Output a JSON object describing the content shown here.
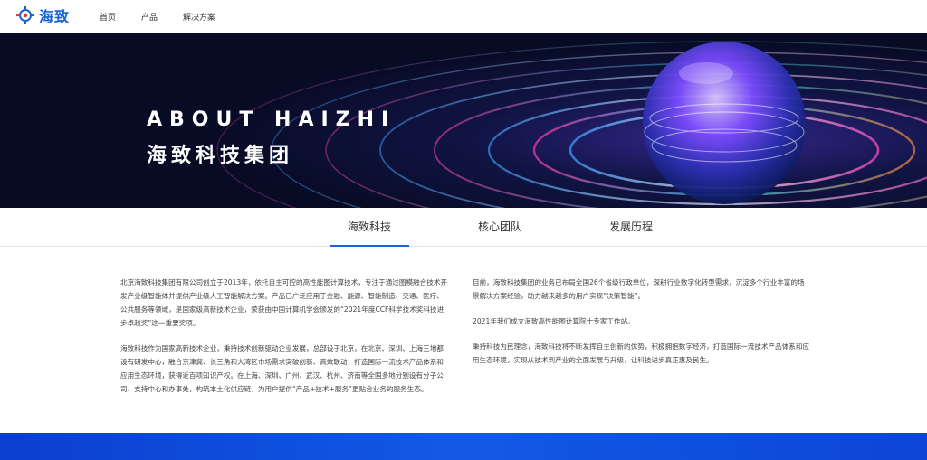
{
  "header": {
    "logo_text": "海致",
    "nav": [
      "首页",
      "产品",
      "解决方案"
    ]
  },
  "hero": {
    "title_en": "ABOUT HAIZHI",
    "title_cn": "海致科技集团"
  },
  "tabs": [
    {
      "label": "海致科技",
      "active": true
    },
    {
      "label": "核心团队",
      "active": false
    },
    {
      "label": "发展历程",
      "active": false
    }
  ],
  "content": {
    "left": [
      "北京海致科技集团有限公司创立于2013年，依托自主可控的高性能图计算技术，专注于通过图模融合技术开发产业级智能体并提供产业级人工智能解决方案。产品已广泛应用于金融、能源、智能制造、交通、医疗、公共服务等领域，是国家级高新技术企业，荣获由中国计算机学会颁发的“2021年度CCF科学技术奖科技进步卓越奖”这一重要奖项。",
      "海致科技作为国家高新技术企业，秉持技术创新驱动企业发展，总部设于北京，在北京、深圳、上海三地都设有研发中心，融合京津冀、长三角和大湾区市场需求突破创新、高效联动，打造国际一流技术产品体系和应用生态环境，获得近百项知识产权。在上海、深圳、广州、武汉、杭州、济南等全国多地分别设有分子公司、支持中心和办事处，构筑本土化供应链，为用户提供“产品+技术+服务”更贴合业务的服务生态。"
    ],
    "right": [
      "目前，海致科技集团的业务已布局全国26个省级行政单位，深耕行业数字化转型需求，沉淀多个行业丰富的场景解决方案经验，助力越来越多的用户实现“决策智能”。",
      "2021年我们成立海致高性能图计算院士专家工作站。",
      "秉持科技为民理念，海致科技将不断发挥自主创新的优势，积极拥抱数字经济，打造国际一流技术产品体系和应用生态环境，实现从技术到产业的全面发展与升级，让科技进步真正惠及民生。"
    ]
  },
  "colors": {
    "brand": "#1a63d6",
    "hero_bg": "#080b24",
    "footer_band": "#1459e6"
  }
}
